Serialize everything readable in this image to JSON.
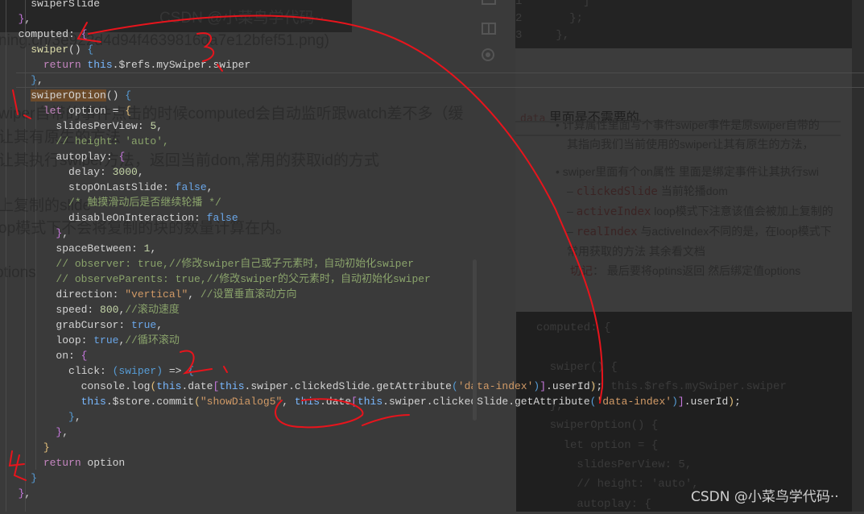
{
  "editor": {
    "lines": [
      [
        [
          "    swiperSlide",
          ""
        ]
      ],
      [
        [
          "  ",
          ""
        ],
        [
          "}",
          "t-br3"
        ],
        [
          ",",
          ""
        ]
      ],
      [
        [
          "  computed: ",
          ""
        ],
        [
          "{",
          "t-br3"
        ]
      ],
      [
        [
          "    swiper",
          "t-fn"
        ],
        [
          "()",
          ""
        ],
        [
          " {",
          "t-br"
        ]
      ],
      [
        [
          "      ",
          ""
        ],
        [
          "return ",
          "t-kw"
        ],
        [
          "this",
          "t-this"
        ],
        [
          ".$refs.mySwiper.swiper",
          ""
        ]
      ],
      [
        [
          "    ",
          ""
        ],
        [
          "}",
          "t-br"
        ],
        [
          ",",
          ""
        ]
      ],
      [
        [
          "    ",
          ""
        ],
        [
          "swiperOption",
          "t-hl"
        ],
        [
          "() ",
          ""
        ],
        [
          "{",
          "t-br"
        ]
      ],
      [
        [
          "      ",
          ""
        ],
        [
          "let ",
          "t-kw"
        ],
        [
          "option = ",
          ""
        ],
        [
          "{",
          "t-br2"
        ]
      ],
      [
        [
          "        slidesPerView: ",
          ""
        ],
        [
          "5",
          "t-num"
        ],
        [
          ",",
          ""
        ]
      ],
      [
        [
          "        // height: 'auto',",
          "t-cmt"
        ]
      ],
      [
        [
          "        autoplay: ",
          ""
        ],
        [
          "{",
          "t-br3"
        ]
      ],
      [
        [
          "          delay: ",
          ""
        ],
        [
          "3000",
          "t-num"
        ],
        [
          ",",
          ""
        ]
      ],
      [
        [
          "          stopOnLastSlide: ",
          ""
        ],
        [
          "false",
          "t-bool"
        ],
        [
          ",",
          ""
        ]
      ],
      [
        [
          "          /* 触摸滑动后是否继续轮播 */",
          "t-cmt"
        ]
      ],
      [
        [
          "          disableOnInteraction: ",
          ""
        ],
        [
          "false",
          "t-bool"
        ]
      ],
      [
        [
          "        ",
          ""
        ],
        [
          "}",
          "t-br3"
        ],
        [
          ",",
          ""
        ]
      ],
      [
        [
          "        spaceBetween: ",
          ""
        ],
        [
          "1",
          "t-num"
        ],
        [
          ",",
          ""
        ]
      ],
      [
        [
          "        // observer: true,//修改swiper自己或子元素时，自动初始化swiper",
          "t-cmt"
        ]
      ],
      [
        [
          "        // observeParents: true,//修改swiper的父元素时，自动初始化swiper",
          "t-cmt"
        ]
      ],
      [
        [
          "        direction: ",
          ""
        ],
        [
          "\"vertical\"",
          "t-str"
        ],
        [
          ", ",
          ""
        ],
        [
          "//设置垂直滚动方向",
          "t-cmt"
        ]
      ],
      [
        [
          "        speed: ",
          ""
        ],
        [
          "800",
          "t-num"
        ],
        [
          ",",
          ""
        ],
        [
          "//滚动速度",
          "t-cmt"
        ]
      ],
      [
        [
          "        grabCursor: ",
          ""
        ],
        [
          "true",
          "t-bool"
        ],
        [
          ",",
          ""
        ]
      ],
      [
        [
          "        loop: ",
          ""
        ],
        [
          "true",
          "t-bool"
        ],
        [
          ",",
          ""
        ],
        [
          "//循环滚动",
          "t-cmt"
        ]
      ],
      [
        [
          "        on: ",
          ""
        ],
        [
          "{",
          "t-br3"
        ]
      ],
      [
        [
          "          click: ",
          ""
        ],
        [
          "(swiper)",
          "t-br"
        ],
        [
          " => ",
          ""
        ],
        [
          "{",
          "t-br"
        ]
      ],
      [
        [
          "            console.log",
          ""
        ],
        [
          "(",
          "t-br2"
        ],
        [
          "this",
          "t-this"
        ],
        [
          ".date",
          ""
        ],
        [
          "[",
          "t-br3"
        ],
        [
          "this",
          "t-this"
        ],
        [
          ".swiper.clickedSlide.getAttribute",
          ""
        ],
        [
          "(",
          "t-br"
        ],
        [
          "'data-index'",
          "t-str"
        ],
        [
          ")",
          "t-br"
        ],
        [
          "]",
          "t-br3"
        ],
        [
          ".userId",
          ""
        ],
        [
          ")",
          "t-br2"
        ],
        [
          ";",
          ""
        ]
      ],
      [
        [
          "            ",
          ""
        ],
        [
          "this",
          "t-this"
        ],
        [
          ".$store.commit",
          ""
        ],
        [
          "(",
          "t-br2"
        ],
        [
          "\"showDialog5\"",
          "t-str"
        ],
        [
          ", ",
          ""
        ],
        [
          "this",
          "t-this"
        ],
        [
          ".date",
          ""
        ],
        [
          "[",
          "t-br3"
        ],
        [
          "this",
          "t-this"
        ],
        [
          ".swiper.clickedSlide.getAttribute",
          ""
        ],
        [
          "(",
          "t-br"
        ],
        [
          "'data-index'",
          "t-str"
        ],
        [
          ")",
          "t-br"
        ],
        [
          "]",
          "t-br3"
        ],
        [
          ".userId",
          ""
        ],
        [
          ")",
          "t-br2"
        ],
        [
          ";",
          ""
        ]
      ],
      [
        [
          "          ",
          ""
        ],
        [
          "}",
          "t-br"
        ],
        [
          ",",
          ""
        ]
      ],
      [
        [
          "        ",
          ""
        ],
        [
          "}",
          "t-br3"
        ],
        [
          ",",
          ""
        ]
      ],
      [
        [
          "      ",
          ""
        ],
        [
          "}",
          "t-br2"
        ]
      ],
      [
        [
          "      ",
          ""
        ],
        [
          "return ",
          "t-kw"
        ],
        [
          "option",
          ""
        ]
      ],
      [
        [
          "    ",
          ""
        ],
        [
          "}",
          "t-br"
        ]
      ],
      [
        [
          "  ",
          ""
        ],
        [
          "}",
          "t-br3"
        ],
        [
          ",",
          ""
        ]
      ]
    ]
  },
  "background_doc": {
    "title_code": "data",
    "title_text": "里面是不需要的",
    "bullets": [
      "计算属性里面写个事件swiper事件是原swiper自带的",
      "其指向我们当前使用的swiper让其有原生的方法，",
      "swiper里面有个on属性 里面是绑定事件让其执行swi",
      "clickedSlide",
      "当前轮播dom",
      "activeIndex",
      "loop模式下注意该值会被加上复制的",
      "realIndex",
      "与activeIndex不同的是，在loop模式下",
      "常用获取的方法 其余看文档",
      "切记",
      "：  最后要将optins返回 然后绑定值options"
    ],
    "left_fragments": [
      "ning.cn/3e922d4d94f4639816da7e12bfef51.png)",
      "wiper自带的事件点击的时候computed会自动监听跟watch差不多（缓",
      "让其有原生的方法",
      "让其执行swiper方法，返回当前dom,常用的获取id的方式",
      "上复制的slide",
      "op模式下不会将复制的块的数量计算在内。",
      "ptions"
    ],
    "bottom_code": "computed: {\n\n  swiper() {\n    return this.$refs.mySwiper.swiper\n  },\n  swiperOption() {\n    let option = {\n      slidesPerView: 5,\n      // height: 'auto',\n      autoplay: {",
    "top_code": "1         ]\n2       };\n3     },"
  },
  "annotations": [
    "1",
    "2",
    "3",
    "4"
  ],
  "watermark": "CSDN @小菜鸟学代码··",
  "icons": [
    "preview-single-icon",
    "split-view-icon",
    "eye-icon"
  ],
  "accent_color": "#e8141c"
}
